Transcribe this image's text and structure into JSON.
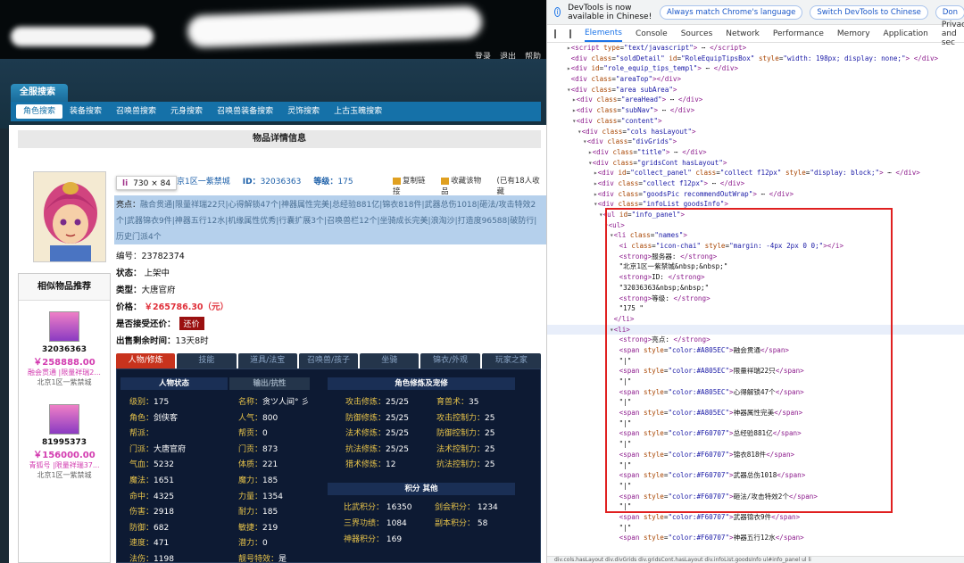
{
  "topbar": {
    "links": [
      "登录",
      "退出",
      "帮助"
    ]
  },
  "nav": {
    "search_tab": "全服搜索",
    "sub_items": [
      "角色搜索",
      "装备搜索",
      "召唤兽搜索",
      "元身搜索",
      "召唤兽装备搜索",
      "灵饰搜索",
      "上古玉魄搜索"
    ]
  },
  "page_title": "物品详情信息",
  "tooltip": {
    "tag": "li",
    "size": "730 × 84"
  },
  "server_line": {
    "server": "京1区一紫禁城",
    "id_label": "ID：",
    "id": "32036363",
    "level_label": "等级：",
    "level": "175"
  },
  "actions": {
    "copy": "复制链接",
    "collect": "收藏该物品",
    "count": "(已有18人收藏"
  },
  "highlight": {
    "label": "亮点：",
    "text": "融合贯通|限量祥瑞22只|心得解锁47个|神器属性完美|总经验881亿|锦衣818件|武器总伤1018|砸法/攻击特效2个|武器锦衣9件|神器五行12水|机缘属性优秀|行囊扩展3个|召唤兽栏12个|坐骑成长完美|浪淘沙|打造度96588|破防行|历史门派4个"
  },
  "attrs": {
    "code": "编号：23782374",
    "status_label": "状态：",
    "status": "上架中",
    "type_label": "类型：",
    "type": "大唐官府",
    "price_label": "价格：",
    "price": "￥265786.30（元）",
    "return_label": "是否接受还价：",
    "return_btn": "还价",
    "time_label": "出售剩余时间：",
    "time": "13天8时"
  },
  "similar": {
    "title": "相似物品推荐",
    "items": [
      {
        "id": "32036363",
        "price": "￥258888.00",
        "desc": "融会贯通 |限量祥瑞2...",
        "server": "北京1区一紫禁城"
      },
      {
        "id": "81995373",
        "price": "￥156000.00",
        "desc": "青狐号 |限量祥瑞37...",
        "server": "北京1区一紫禁城"
      }
    ]
  },
  "tabs": [
    "人物/修炼",
    "技能",
    "道具/法宝",
    "召唤兽/孩子",
    "坐骑",
    "锦衣/外观",
    "玩家之家"
  ],
  "panel": {
    "heads": {
      "status": "人物状态",
      "output": "输出/抗性",
      "cultivate": "角色修炼及宠修",
      "score": "积分 其他"
    },
    "col1": [
      [
        "级别：",
        "175"
      ],
      [
        "角色：",
        "剑侠客"
      ],
      [
        "帮派：",
        ""
      ],
      [
        "门派：",
        "大唐官府"
      ],
      [
        "气血：",
        "5232"
      ],
      [
        "魔法：",
        "1651"
      ],
      [
        "命中：",
        "4325"
      ],
      [
        "伤害：",
        "2918"
      ],
      [
        "防御：",
        "682"
      ],
      [
        "速度：",
        "471"
      ],
      [
        "法伤：",
        "1198"
      ]
    ],
    "col2": [
      [
        "名称：",
        "贪ツ人间° 彡"
      ],
      [
        "人气：",
        "800"
      ],
      [
        "帮贡：",
        "0"
      ],
      [
        "门贡：",
        "873"
      ],
      [
        "体质：",
        "221"
      ],
      [
        "魔力：",
        "185"
      ],
      [
        "力量：",
        "1354"
      ],
      [
        "耐力：",
        "185"
      ],
      [
        "敏捷：",
        "219"
      ],
      [
        "潜力：",
        "0"
      ],
      [
        "靓号特效：",
        "是"
      ]
    ],
    "col3": [
      [
        "攻击修炼：",
        "25/25"
      ],
      [
        "防御修炼：",
        "25/25"
      ],
      [
        "法术修炼：",
        "25/25"
      ],
      [
        "抗法修炼：",
        "25/25"
      ],
      [
        "猎术修炼：",
        "12"
      ]
    ],
    "col4": [
      [
        "育兽术：",
        "35"
      ],
      [
        "攻击控制力：",
        "25"
      ],
      [
        "防御控制力：",
        "25"
      ],
      [
        "法术控制力：",
        "25"
      ],
      [
        "抗法控制力：",
        "25"
      ]
    ],
    "score": [
      [
        "比武积分：",
        "16350",
        "剑会积分：",
        "1234"
      ],
      [
        "三界功绩：",
        "1084",
        "副本积分：",
        "58"
      ],
      [
        "神器积分：",
        "169",
        "",
        ""
      ]
    ]
  },
  "devtools": {
    "info_text": "DevTools is now available in Chinese!",
    "btn1": "Always match Chrome's language",
    "btn2": "Switch DevTools to Chinese",
    "btn3": "Don",
    "tabs": [
      "Elements",
      "Console",
      "Sources",
      "Network",
      "Performance",
      "Memory",
      "Application",
      "Privacy and sec"
    ],
    "lines": [
      {
        "ind": 2,
        "arrow": "▸",
        "html": "<span class='tg'>&lt;script</span> <span class='an'>type</span>=<span class='av'>\"text/javascript\"</span><span class='tg'>&gt;</span> ⋯ <span class='tg'>&lt;/script&gt;</span>"
      },
      {
        "ind": 2,
        "arrow": " ",
        "html": "<span class='tg'>&lt;div</span> <span class='an'>class</span>=<span class='av'>\"soldDetail\"</span> <span class='an'>id</span>=<span class='av'>\"RoleEquipTipsBox\"</span> <span class='an'>style</span>=<span class='av'>\"width: 198px; display: none;\"</span><span class='tg'>&gt;</span> <span class='tg'>&lt;/div&gt;</span>"
      },
      {
        "ind": 2,
        "arrow": "▸",
        "html": "<span class='tg'>&lt;div</span> <span class='an'>id</span>=<span class='av'>\"role_equip_tips_templ\"</span><span class='tg'>&gt;</span> ⋯ <span class='tg'>&lt;/div&gt;</span>"
      },
      {
        "ind": 2,
        "arrow": " ",
        "html": "<span class='tg'>&lt;div</span> <span class='an'>class</span>=<span class='av'>\"areaTop\"</span><span class='tg'>&gt;&lt;/div&gt;</span>"
      },
      {
        "ind": 2,
        "arrow": "▾",
        "html": "<span class='tg'>&lt;div</span> <span class='an'>class</span>=<span class='av'>\"area subArea\"</span><span class='tg'>&gt;</span>"
      },
      {
        "ind": 3,
        "arrow": "▸",
        "html": "<span class='tg'>&lt;div</span> <span class='an'>class</span>=<span class='av'>\"areaHead\"</span><span class='tg'>&gt;</span> ⋯ <span class='tg'>&lt;/div&gt;</span>"
      },
      {
        "ind": 3,
        "arrow": "▸",
        "html": "<span class='tg'>&lt;div</span> <span class='an'>class</span>=<span class='av'>\"subNav\"</span><span class='tg'>&gt;</span> ⋯ <span class='tg'>&lt;/div&gt;</span>"
      },
      {
        "ind": 3,
        "arrow": "▾",
        "html": "<span class='tg'>&lt;div</span> <span class='an'>class</span>=<span class='av'>\"content\"</span><span class='tg'>&gt;</span>"
      },
      {
        "ind": 4,
        "arrow": "▾",
        "html": "<span class='tg'>&lt;div</span> <span class='an'>class</span>=<span class='av'>\"cols hasLayout\"</span><span class='tg'>&gt;</span>"
      },
      {
        "ind": 5,
        "arrow": "▾",
        "html": "<span class='tg'>&lt;div</span> <span class='an'>class</span>=<span class='av'>\"divGrids\"</span><span class='tg'>&gt;</span>"
      },
      {
        "ind": 6,
        "arrow": "▸",
        "html": "<span class='tg'>&lt;div</span> <span class='an'>class</span>=<span class='av'>\"title\"</span><span class='tg'>&gt;</span> ⋯ <span class='tg'>&lt;/div&gt;</span>"
      },
      {
        "ind": 6,
        "arrow": "▾",
        "html": "<span class='tg'>&lt;div</span> <span class='an'>class</span>=<span class='av'>\"gridsCont hasLayout\"</span><span class='tg'>&gt;</span>"
      },
      {
        "ind": 7,
        "arrow": "▸",
        "html": "<span class='tg'>&lt;div</span> <span class='an'>id</span>=<span class='av'>\"collect_panel\"</span> <span class='an'>class</span>=<span class='av'>\"collect f12px\"</span> <span class='an'>style</span>=<span class='av'>\"display: block;\"</span><span class='tg'>&gt;</span> ⋯ <span class='tg'>&lt;/div&gt;</span>"
      },
      {
        "ind": 7,
        "arrow": "▸",
        "html": "<span class='tg'>&lt;div</span> <span class='an'>class</span>=<span class='av'>\"collect f12px\"</span><span class='tg'>&gt;</span> ⋯ <span class='tg'>&lt;/div&gt;</span>"
      },
      {
        "ind": 7,
        "arrow": "▸",
        "html": "<span class='tg'>&lt;div</span> <span class='an'>class</span>=<span class='av'>\"goodsPic recommendOutWrap\"</span><span class='tg'>&gt;</span> ⋯ <span class='tg'>&lt;/div&gt;</span>"
      },
      {
        "ind": 7,
        "arrow": "▾",
        "html": "<span class='tg'>&lt;div</span> <span class='an'>class</span>=<span class='av'>\"infoList goodsInfo\"</span><span class='tg'>&gt;</span>"
      },
      {
        "ind": 8,
        "arrow": "▾",
        "html": "<span class='tg'>&lt;ul</span> <span class='an'>id</span>=<span class='av'>\"info_panel\"</span><span class='tg'>&gt;</span>"
      },
      {
        "ind": 9,
        "arrow": "▾",
        "html": "<span class='tg'>&lt;ul&gt;</span>"
      },
      {
        "ind": 10,
        "arrow": "▾",
        "html": "<span class='tg'>&lt;li</span> <span class='an'>class</span>=<span class='av'>\"names\"</span><span class='tg'>&gt;</span>"
      },
      {
        "ind": 11,
        "arrow": " ",
        "html": "<span class='tg'>&lt;i</span> <span class='an'>class</span>=<span class='av'>\"icon-chai\"</span> <span class='an'>style</span>=<span class='av'>\"margin: -4px 2px 0 0;\"</span><span class='tg'>&gt;&lt;/i&gt;</span>"
      },
      {
        "ind": 11,
        "arrow": " ",
        "html": "<span class='tg'>&lt;strong&gt;</span>服务器: <span class='tg'>&lt;/strong&gt;</span>"
      },
      {
        "ind": 11,
        "arrow": " ",
        "html": "<span class='tx'>\"北京1区一紫禁城&amp;nbsp;&amp;nbsp;\"</span>"
      },
      {
        "ind": 11,
        "arrow": " ",
        "html": "<span class='tg'>&lt;strong&gt;</span>ID: <span class='tg'>&lt;/strong&gt;</span>"
      },
      {
        "ind": 11,
        "arrow": " ",
        "html": "<span class='tx'>\"32036363&amp;nbsp;&amp;nbsp;\"</span>"
      },
      {
        "ind": 11,
        "arrow": " ",
        "html": "<span class='tg'>&lt;strong&gt;</span>等级: <span class='tg'>&lt;/strong&gt;</span>"
      },
      {
        "ind": 11,
        "arrow": " ",
        "html": "<span class='tx'>\"175 \"</span>"
      },
      {
        "ind": 10,
        "arrow": " ",
        "html": "<span class='tg'>&lt;/li&gt;</span>"
      },
      {
        "ind": 10,
        "arrow": "▾",
        "html": "<span class='tg'>&lt;li&gt;</span>",
        "sel": true
      },
      {
        "ind": 11,
        "arrow": " ",
        "html": "<span class='tg'>&lt;strong&gt;</span>亮点: <span class='tg'>&lt;/strong&gt;</span>"
      },
      {
        "ind": 11,
        "arrow": " ",
        "html": "<span class='tg'>&lt;span</span> <span class='an'>style</span>=<span class='av'>\"color:#A805EC\"</span><span class='tg'>&gt;</span>融会贯通<span class='tg'>&lt;/span&gt;</span>"
      },
      {
        "ind": 11,
        "arrow": " ",
        "html": "<span class='tx'>\"|\"</span>"
      },
      {
        "ind": 11,
        "arrow": " ",
        "html": "<span class='tg'>&lt;span</span> <span class='an'>style</span>=<span class='av'>\"color:#A805EC\"</span><span class='tg'>&gt;</span>限量祥瑞22只<span class='tg'>&lt;/span&gt;</span>"
      },
      {
        "ind": 11,
        "arrow": " ",
        "html": "<span class='tx'>\"|\"</span>"
      },
      {
        "ind": 11,
        "arrow": " ",
        "html": "<span class='tg'>&lt;span</span> <span class='an'>style</span>=<span class='av'>\"color:#A805EC\"</span><span class='tg'>&gt;</span>心得解锁47个<span class='tg'>&lt;/span&gt;</span>"
      },
      {
        "ind": 11,
        "arrow": " ",
        "html": "<span class='tx'>\"|\"</span>"
      },
      {
        "ind": 11,
        "arrow": " ",
        "html": "<span class='tg'>&lt;span</span> <span class='an'>style</span>=<span class='av'>\"color:#A805EC\"</span><span class='tg'>&gt;</span>神器属性完美<span class='tg'>&lt;/span&gt;</span>"
      },
      {
        "ind": 11,
        "arrow": " ",
        "html": "<span class='tx'>\"|\"</span>"
      },
      {
        "ind": 11,
        "arrow": " ",
        "html": "<span class='tg'>&lt;span</span> <span class='an'>style</span>=<span class='av'>\"color:#F60707\"</span><span class='tg'>&gt;</span>总经验881亿<span class='tg'>&lt;/span&gt;</span>"
      },
      {
        "ind": 11,
        "arrow": " ",
        "html": "<span class='tx'>\"|\"</span>"
      },
      {
        "ind": 11,
        "arrow": " ",
        "html": "<span class='tg'>&lt;span</span> <span class='an'>style</span>=<span class='av'>\"color:#F60707\"</span><span class='tg'>&gt;</span>锦衣818件<span class='tg'>&lt;/span&gt;</span>"
      },
      {
        "ind": 11,
        "arrow": " ",
        "html": "<span class='tx'>\"|\"</span>"
      },
      {
        "ind": 11,
        "arrow": " ",
        "html": "<span class='tg'>&lt;span</span> <span class='an'>style</span>=<span class='av'>\"color:#F60707\"</span><span class='tg'>&gt;</span>武器总伤1018<span class='tg'>&lt;/span&gt;</span>"
      },
      {
        "ind": 11,
        "arrow": " ",
        "html": "<span class='tx'>\"|\"</span>"
      },
      {
        "ind": 11,
        "arrow": " ",
        "html": "<span class='tg'>&lt;span</span> <span class='an'>style</span>=<span class='av'>\"color:#F60707\"</span><span class='tg'>&gt;</span>砸法/攻击特效2个<span class='tg'>&lt;/span&gt;</span>"
      },
      {
        "ind": 11,
        "arrow": " ",
        "html": "<span class='tx'>\"|\"</span>"
      },
      {
        "ind": 11,
        "arrow": " ",
        "html": "<span class='tg'>&lt;span</span> <span class='an'>style</span>=<span class='av'>\"color:#F60707\"</span><span class='tg'>&gt;</span>武器锦衣9件<span class='tg'>&lt;/span&gt;</span>"
      },
      {
        "ind": 11,
        "arrow": " ",
        "html": "<span class='tx'>\"|\"</span>"
      },
      {
        "ind": 11,
        "arrow": " ",
        "html": "<span class='tg'>&lt;span</span> <span class='an'>style</span>=<span class='av'>\"color:#F60707\"</span><span class='tg'>&gt;</span>神器五行12水<span class='tg'>&lt;/span&gt;</span>"
      }
    ],
    "bottom": "div.cols.hasLayout  div.divGrids  div.gridsCont.hasLayout  div.infoList.goodsInfo  ul#info_panel  ul  li"
  }
}
